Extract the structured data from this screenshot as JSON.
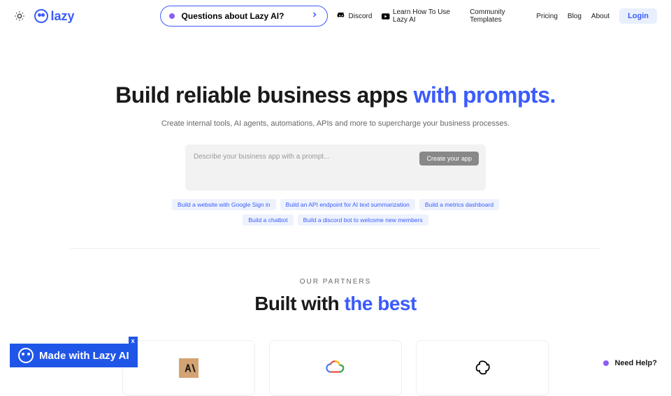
{
  "header": {
    "logo_text": "lazy",
    "search_text": "Questions about Lazy AI?",
    "nav": {
      "discord": "Discord",
      "learn": "Learn How To Use Lazy AI",
      "templates": "Community Templates",
      "pricing": "Pricing",
      "blog": "Blog",
      "about": "About",
      "login": "Login"
    }
  },
  "hero": {
    "title_plain": "Build reliable business apps ",
    "title_accent": "with prompts.",
    "subtitle": "Create internal tools, AI agents, automations, APIs and more to supercharge your business processes.",
    "prompt_placeholder": "Describe your business app with a prompt...",
    "create_button": "Create your app",
    "suggestions": [
      "Build a website with Google Sign in",
      "Build an API endpoint for AI text summarization",
      "Build a metrics dashboard",
      "Build a chatbot",
      "Build a discord bot to welcome new members"
    ]
  },
  "partners": {
    "label": "OUR PARTNERS",
    "title_plain": "Built with ",
    "title_accent": "the best"
  },
  "badge": {
    "text": "Made with Lazy AI",
    "close": "x"
  },
  "help": {
    "text": "Need Help?"
  }
}
